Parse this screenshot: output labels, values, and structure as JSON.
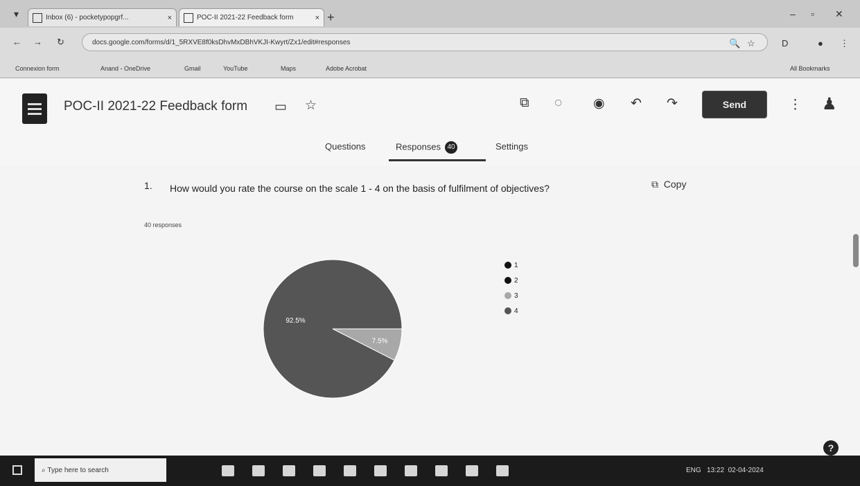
{
  "browser": {
    "tabs": [
      {
        "label": "Inbox (6) - pocketypopgrf..."
      },
      {
        "label": "POC-II 2021-22 Feedback form"
      }
    ],
    "new_tab": "+",
    "url": "docs.google.com/forms/d/1_5RXVE8f0ksDhvMxDBhVKJI-Kwyrt/Zx1/edit#responses",
    "bookmarks": [
      "Connexion form",
      "Anand - OneDrive",
      "Gmail",
      "YouTube",
      "Maps",
      "Adobe Acrobat"
    ],
    "all_bookmarks": "All Bookmarks"
  },
  "header": {
    "title": "POC-II 2021-22 Feedback form",
    "send_label": "Send"
  },
  "tabs": {
    "questions": "Questions",
    "responses": "Responses",
    "responses_count": "40",
    "settings": "Settings"
  },
  "question": {
    "number": "1.",
    "text": "How would you rate the course on the scale 1 - 4 on the basis of fulfilment of objectives?",
    "responses_label": "40 responses",
    "copy_label": "Copy"
  },
  "chart_data": {
    "type": "pie",
    "categories": [
      "1",
      "2",
      "3",
      "4"
    ],
    "values": [
      0,
      0,
      7.5,
      92.5
    ],
    "labels_shown": [
      "92.5%",
      "7.5%"
    ],
    "legend_position": "right",
    "colors": [
      "#111111",
      "#111111",
      "#a8a8a8",
      "#555555"
    ]
  },
  "taskbar": {
    "search_placeholder": "Type here to search",
    "time": "13:22",
    "date": "02-04-2024",
    "lang": "ENG"
  },
  "colors": {
    "send_bg": "#333333",
    "background": "#f4f4f4"
  }
}
